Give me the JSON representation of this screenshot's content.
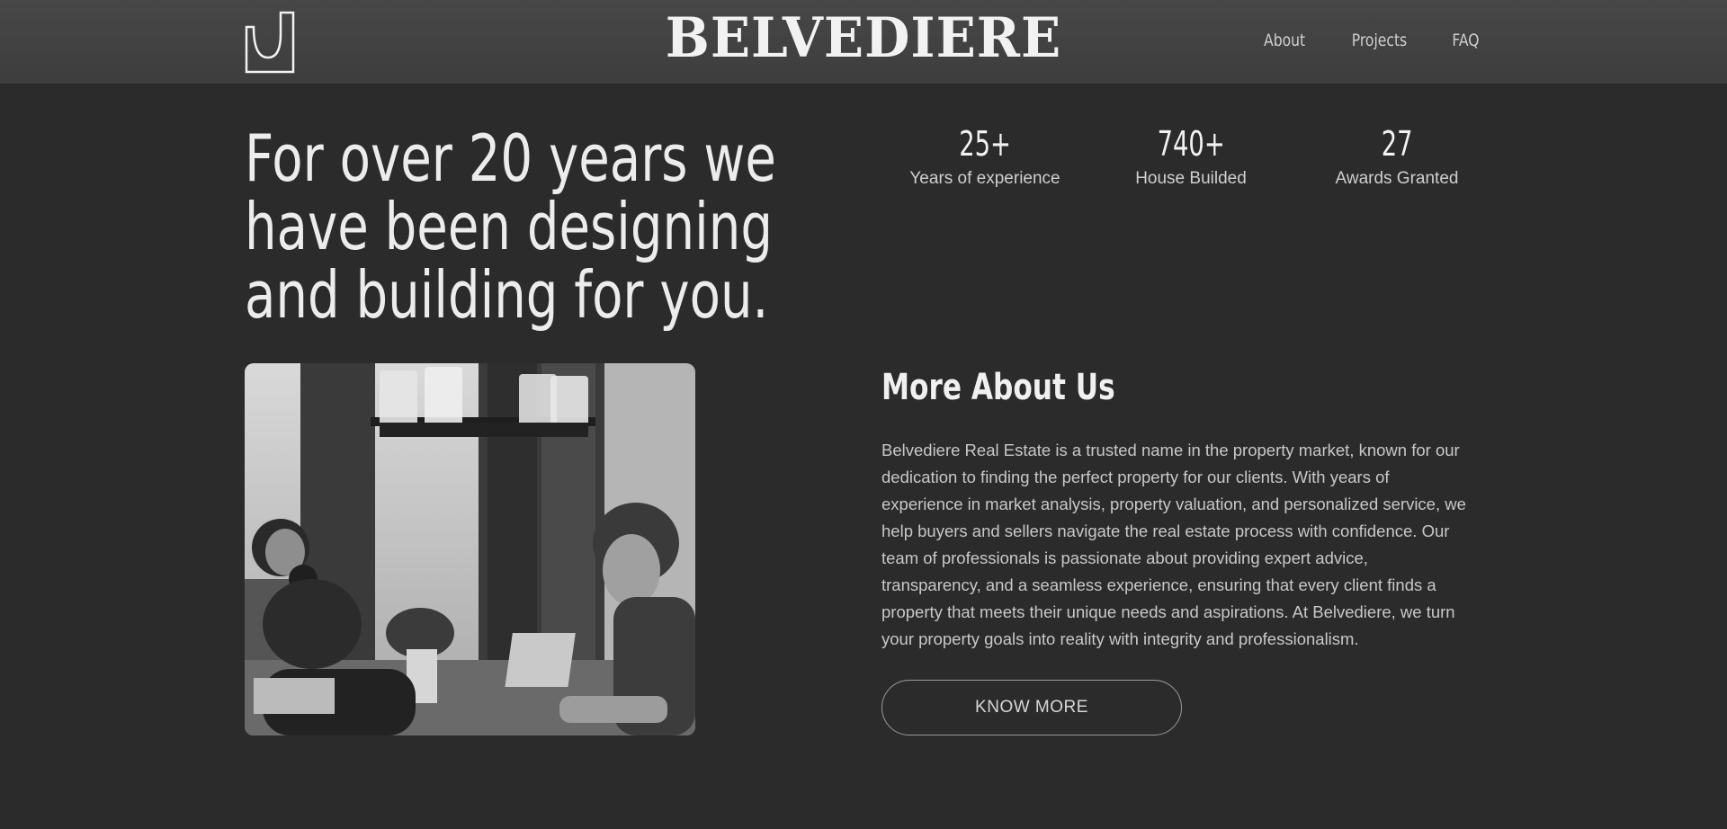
{
  "header": {
    "brand": "BELVEDIERE",
    "nav": [
      "About",
      "Projects",
      "FAQ"
    ]
  },
  "hero": {
    "title": "For over 20 years we have been designing and building for you."
  },
  "stats": [
    {
      "value": "25+",
      "label": "Years of experience"
    },
    {
      "value": "740+",
      "label": "House Builded"
    },
    {
      "value": "27",
      "label": "Awards Granted"
    }
  ],
  "about": {
    "title": "More About Us",
    "body": "Belvediere Real Estate is a trusted name in the property market, known for our dedication to finding the perfect property for our clients. With years of experience in market analysis, property valuation, and personalized service, we help buyers and sellers navigate the real estate process with confidence. Our team of professionals is passionate about providing expert advice, transparency, and a seamless experience, ensuring that every client finds a property that meets their unique needs and aspirations. At Belvediere, we turn your property goals into reality with integrity and professionalism.",
    "button": "KNOW MORE"
  },
  "colors": {
    "background": "#2b2b2b",
    "header": "#424242",
    "text": "#ececec"
  }
}
